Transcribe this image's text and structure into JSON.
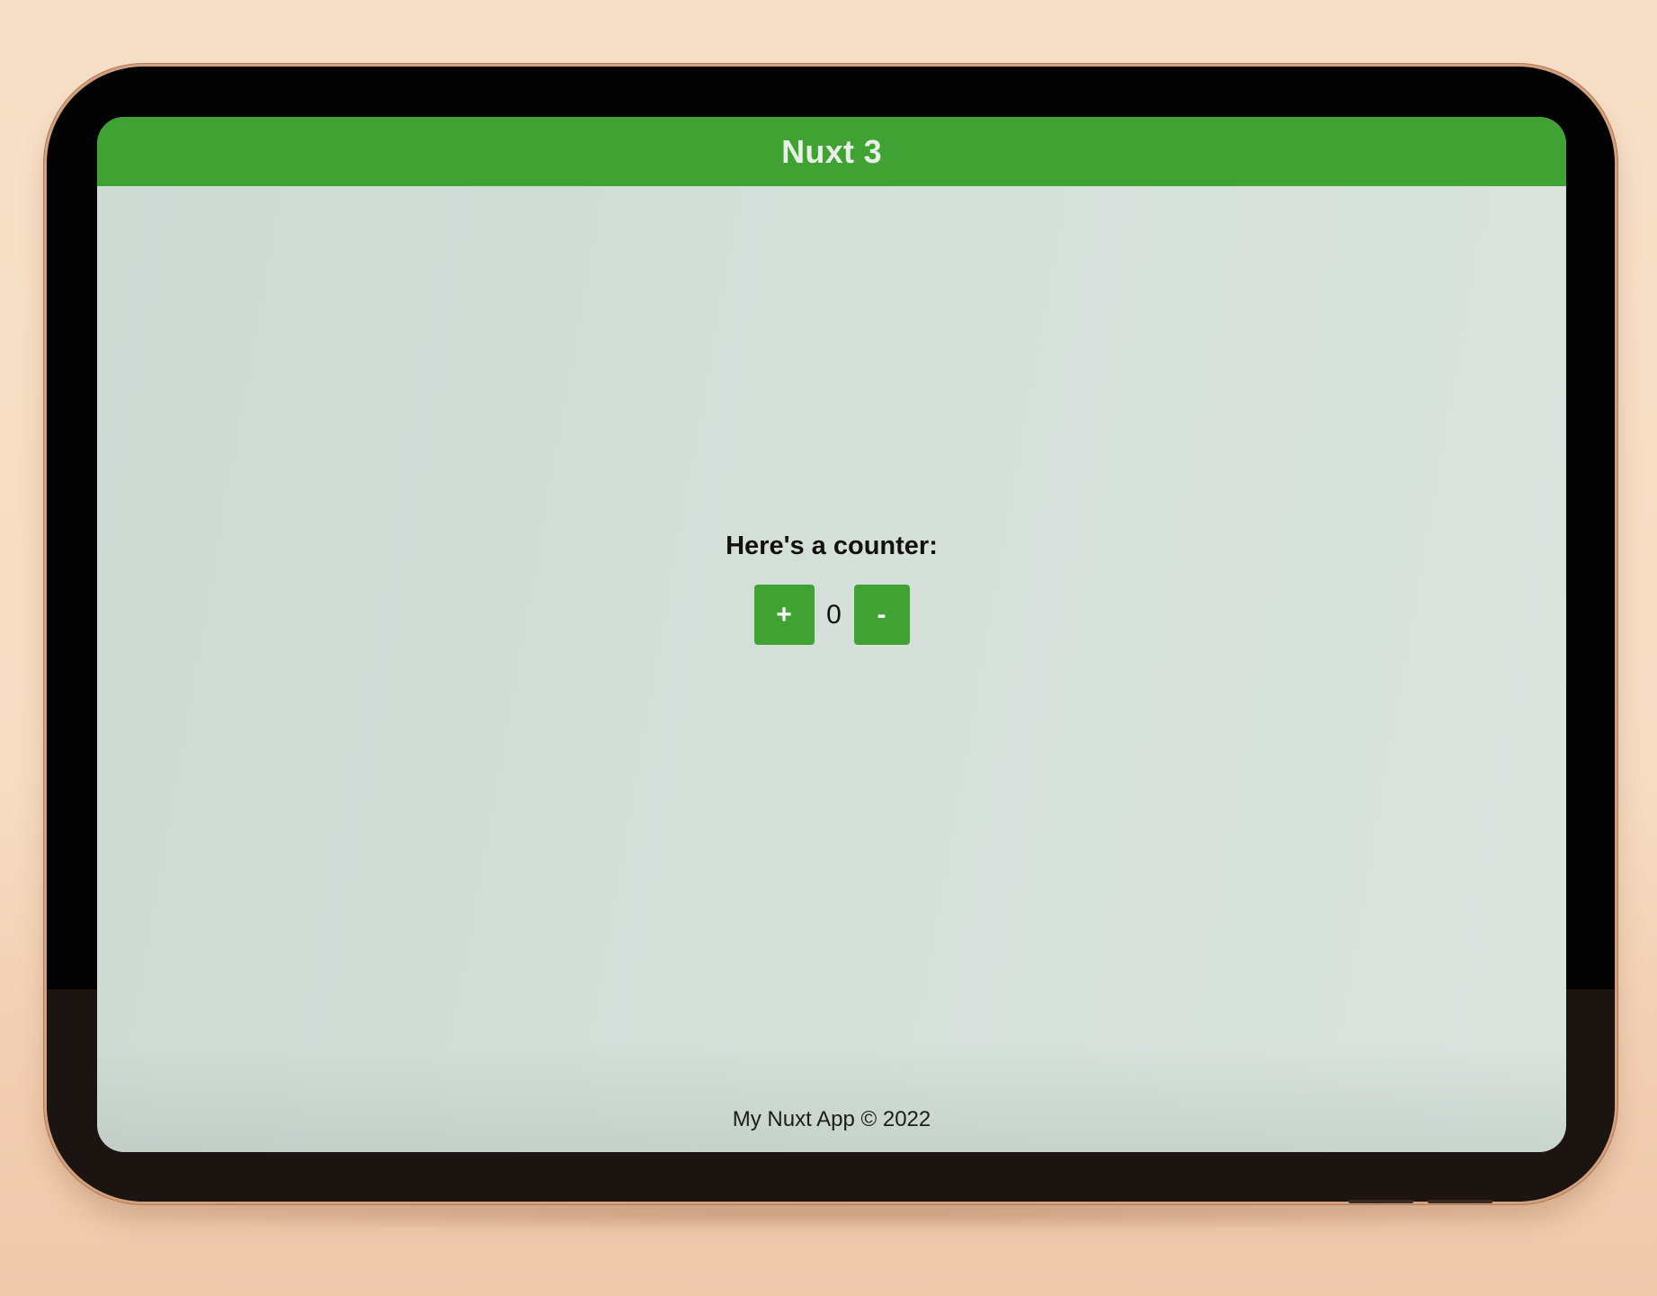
{
  "header": {
    "title": "Nuxt 3"
  },
  "counter": {
    "label": "Here's a counter:",
    "increment_label": "+",
    "value": "0",
    "decrement_label": "-"
  },
  "footer": {
    "text": "My Nuxt App © 2022"
  },
  "colors": {
    "accent": "#3fa232",
    "page_background": "#d4ddd8",
    "backdrop": "#f6dcc3"
  }
}
